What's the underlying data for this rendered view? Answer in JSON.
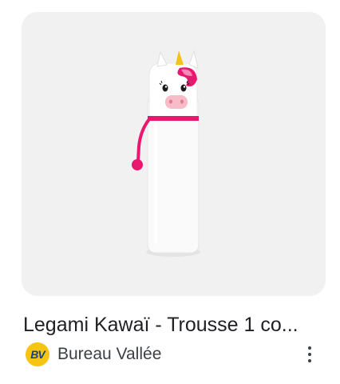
{
  "product": {
    "title": "Legami Kawaï - Trousse 1 co...",
    "image_icon": "unicorn-pencil-case-image"
  },
  "source": {
    "logo_text": "BV",
    "name": "Bureau Vallée",
    "logo_color": "#f6c514",
    "logo_text_color": "#1a3e8a"
  },
  "actions": {
    "more_icon": "more-vert-icon"
  },
  "colors": {
    "image_background": "#f1f1f1",
    "accent_pink": "#e8186f",
    "title_color": "#202124"
  }
}
